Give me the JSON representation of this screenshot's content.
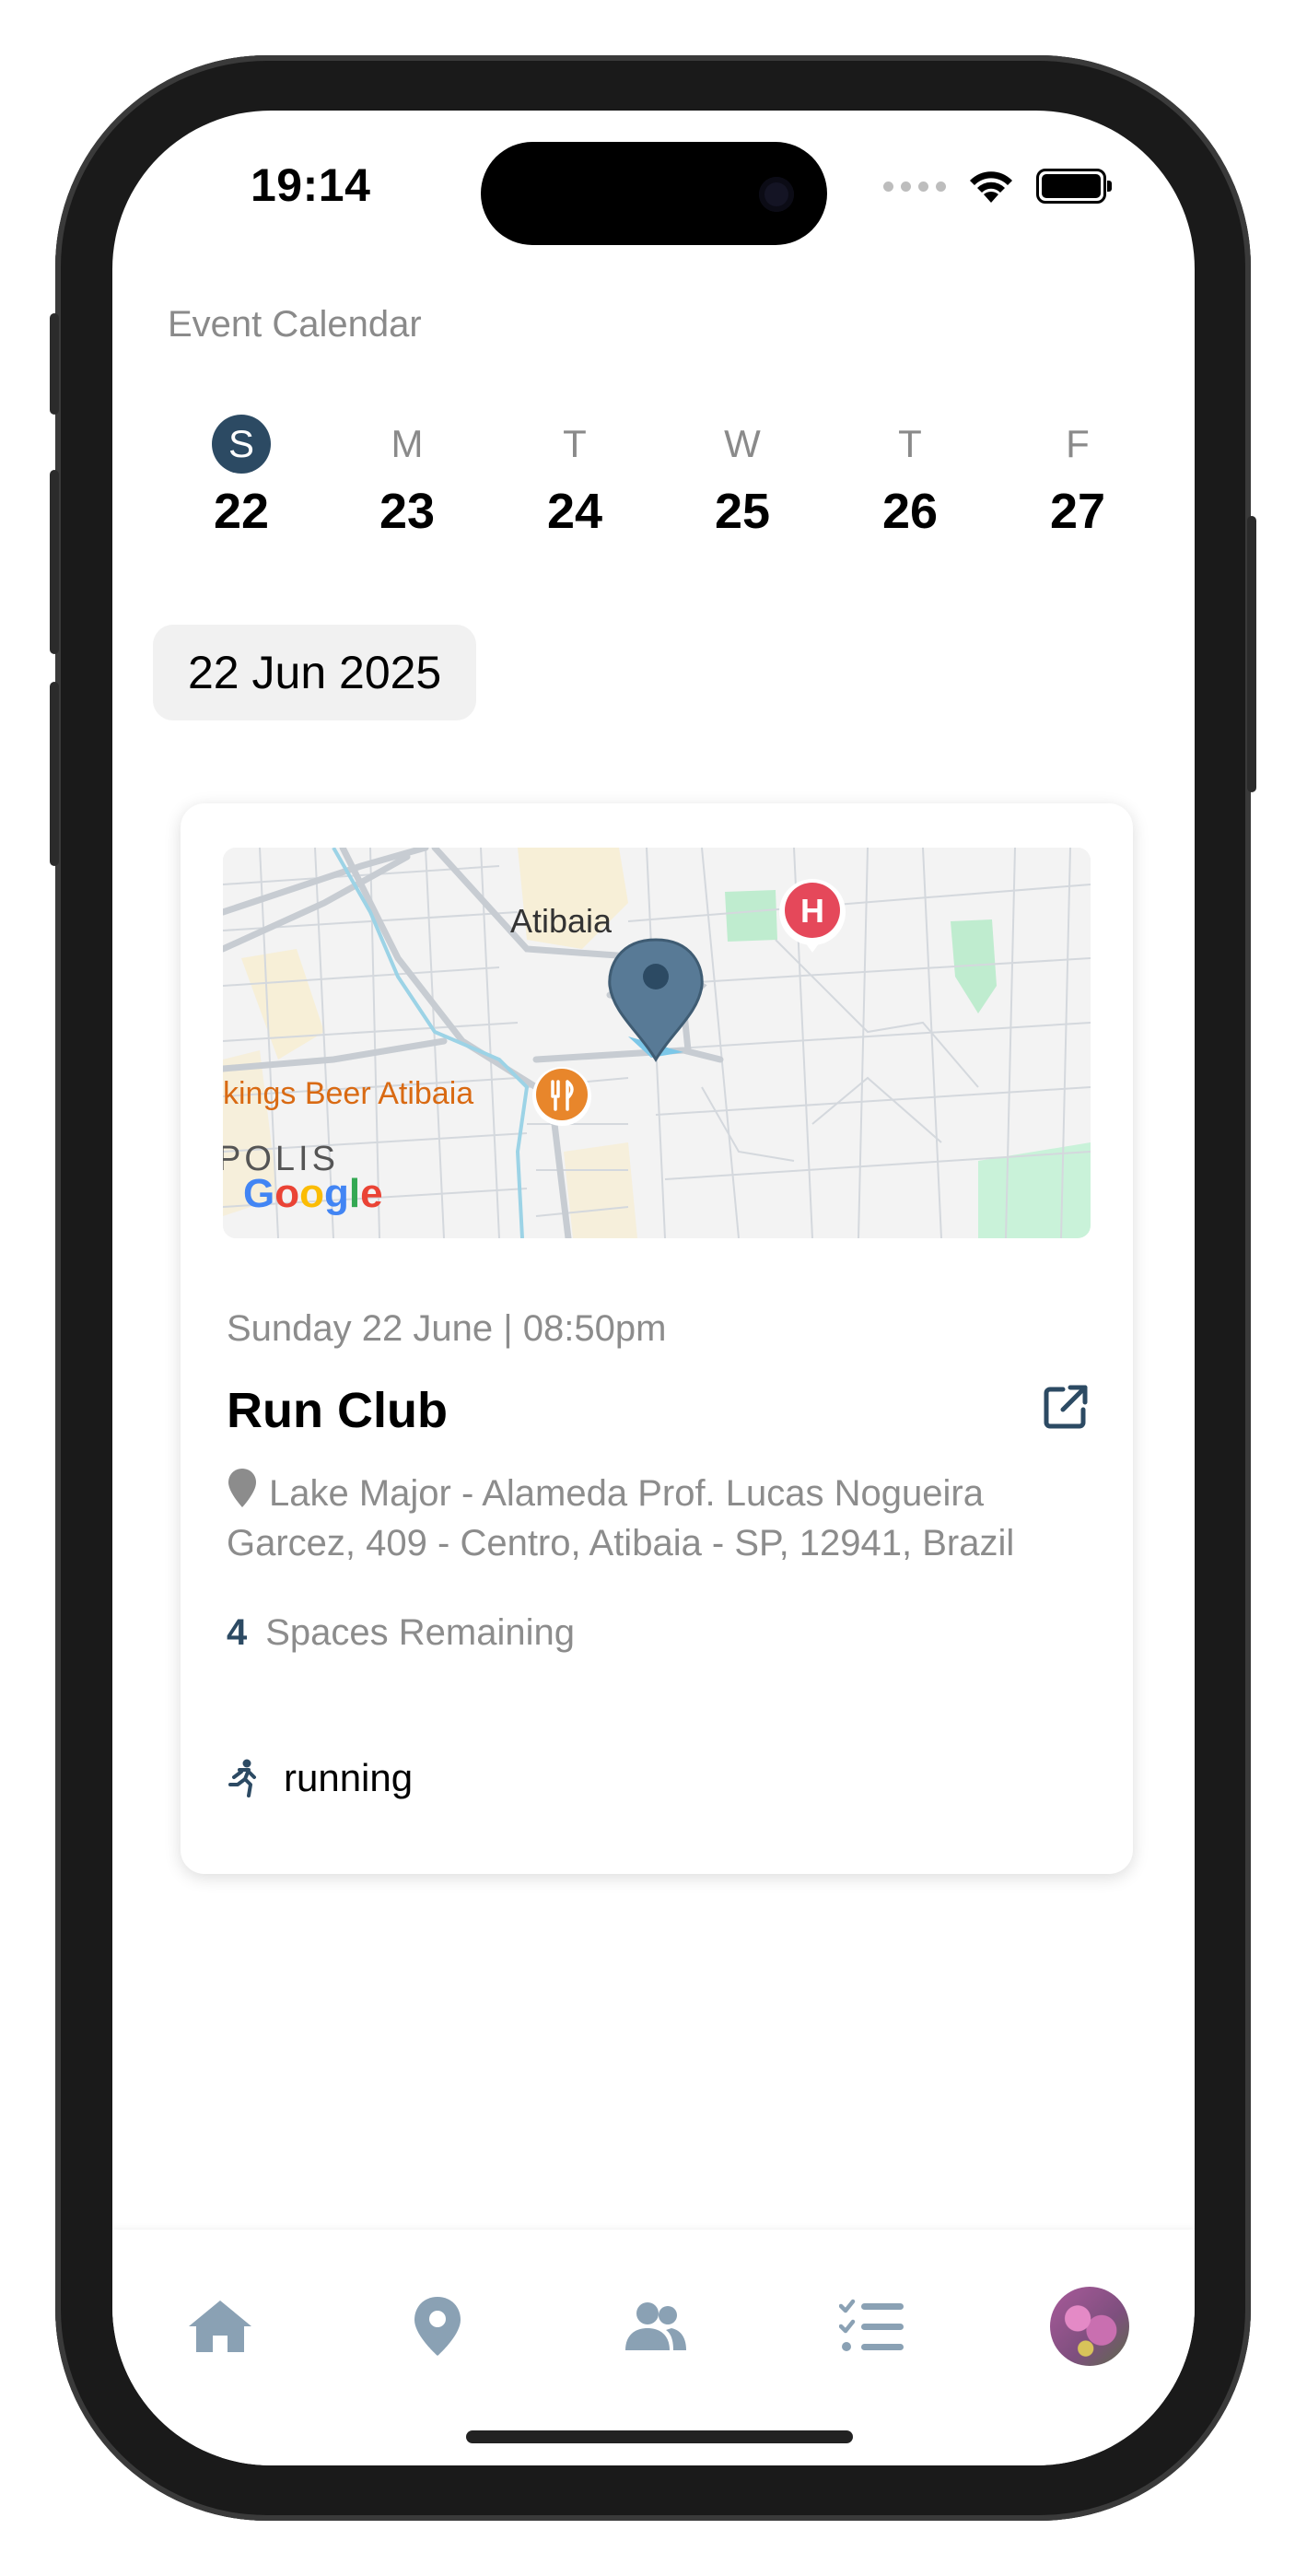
{
  "status_bar": {
    "time": "19:14"
  },
  "header": {
    "section_title": "Event Calendar"
  },
  "week": [
    {
      "letter": "S",
      "date": "22",
      "selected": true
    },
    {
      "letter": "M",
      "date": "23"
    },
    {
      "letter": "T",
      "date": "24"
    },
    {
      "letter": "W",
      "date": "25"
    },
    {
      "letter": "T",
      "date": "26"
    },
    {
      "letter": "F",
      "date": "27"
    }
  ],
  "selected_date_label": "22 Jun 2025",
  "event": {
    "datetime": "Sunday 22 June | 08:50pm",
    "title": "Run Club",
    "address": "Lake Major - Alameda Prof. Lucas Nogueira Garcez, 409 - Centro, Atibaia - SP, 12941, Brazil",
    "spaces_count": "4",
    "spaces_label": "Spaces Remaining",
    "activity": "running",
    "map": {
      "city_label": "Atibaia",
      "poi_label": "kings Beer Atibaia",
      "district_label": "POLIS",
      "provider": "Google",
      "hospital_marker": "H"
    }
  },
  "tabs": [
    "home-icon",
    "location-icon",
    "group-icon",
    "checklist-icon",
    "avatar"
  ],
  "colors": {
    "accent": "#2c4a63",
    "tab_icon": "#8aa1b4",
    "muted_text": "#8c8c8c",
    "poi_orange": "#e8862b",
    "hospital_red": "#e5485a"
  }
}
